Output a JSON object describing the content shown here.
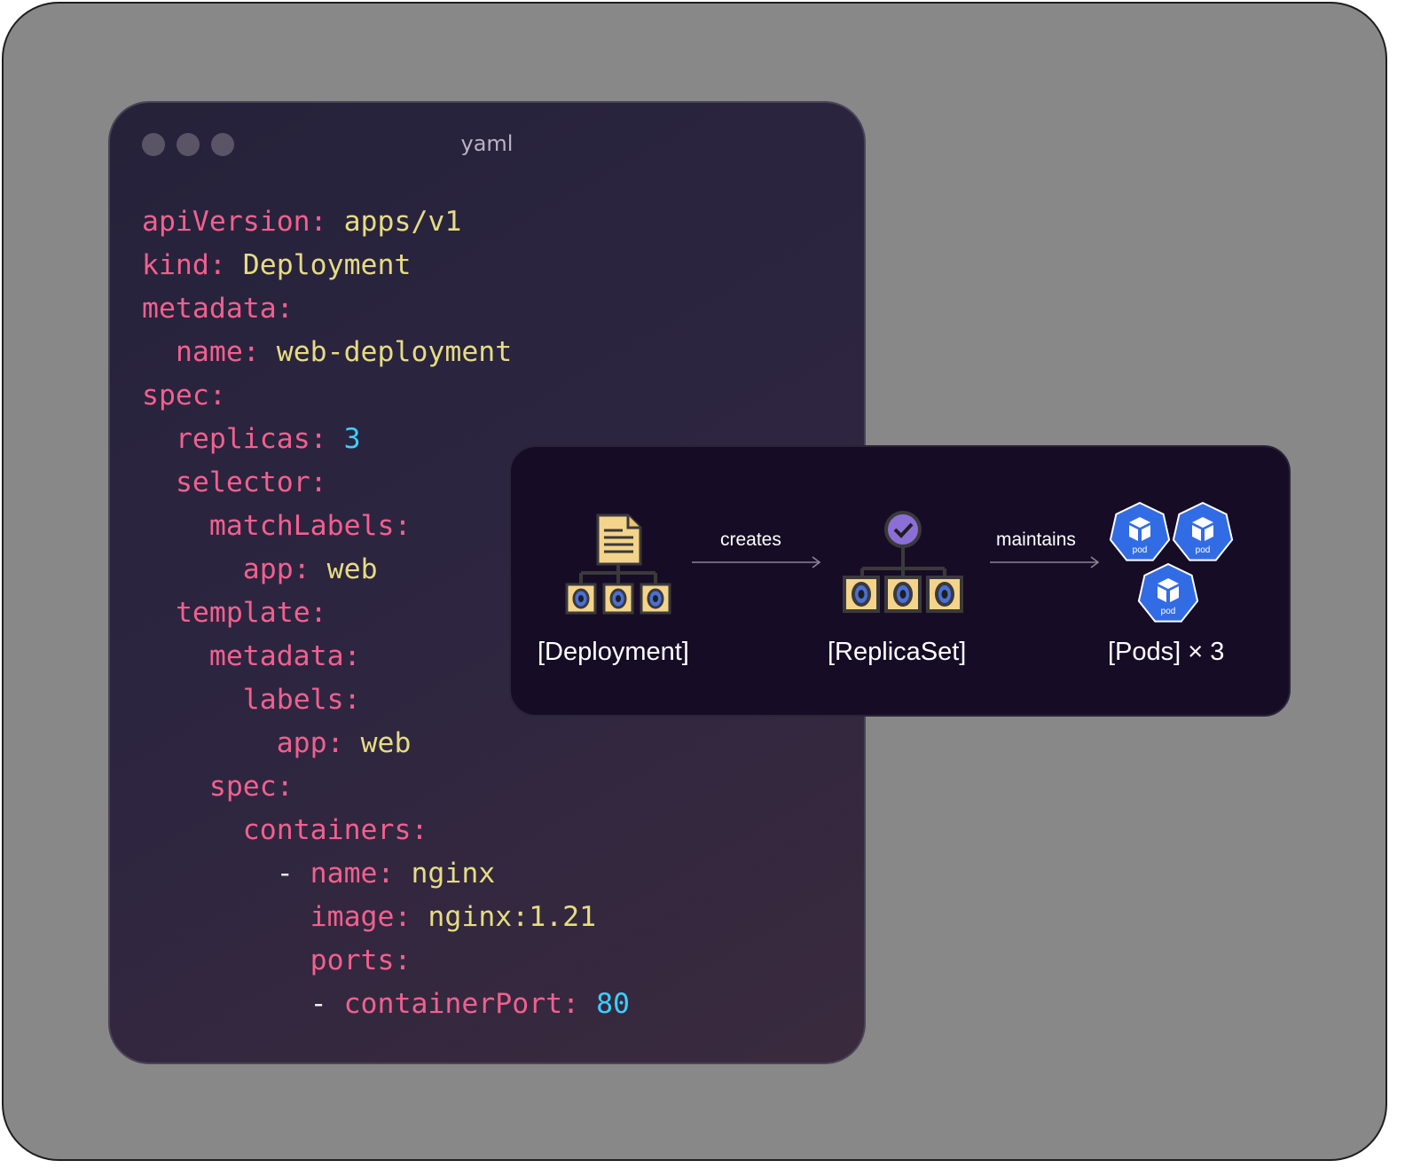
{
  "editor": {
    "title": "yaml",
    "lines": [
      {
        "indent": "",
        "dash": "",
        "key": "apiVersion",
        "value": "apps/v1",
        "vtype": "s"
      },
      {
        "indent": "",
        "dash": "",
        "key": "kind",
        "value": "Deployment",
        "vtype": "s"
      },
      {
        "indent": "",
        "dash": "",
        "key": "metadata",
        "value": "",
        "vtype": "s"
      },
      {
        "indent": "  ",
        "dash": "",
        "key": "name",
        "value": "web-deployment",
        "vtype": "s"
      },
      {
        "indent": "",
        "dash": "",
        "key": "spec",
        "value": "",
        "vtype": "s"
      },
      {
        "indent": "  ",
        "dash": "",
        "key": "replicas",
        "value": "3",
        "vtype": "n"
      },
      {
        "indent": "  ",
        "dash": "",
        "key": "selector",
        "value": "",
        "vtype": "s"
      },
      {
        "indent": "    ",
        "dash": "",
        "key": "matchLabels",
        "value": "",
        "vtype": "s"
      },
      {
        "indent": "      ",
        "dash": "",
        "key": "app",
        "value": "web",
        "vtype": "s"
      },
      {
        "indent": "  ",
        "dash": "",
        "key": "template",
        "value": "",
        "vtype": "s"
      },
      {
        "indent": "    ",
        "dash": "",
        "key": "metadata",
        "value": "",
        "vtype": "s"
      },
      {
        "indent": "      ",
        "dash": "",
        "key": "labels",
        "value": "",
        "vtype": "s"
      },
      {
        "indent": "        ",
        "dash": "",
        "key": "app",
        "value": "web",
        "vtype": "s"
      },
      {
        "indent": "    ",
        "dash": "",
        "key": "spec",
        "value": "",
        "vtype": "s"
      },
      {
        "indent": "      ",
        "dash": "",
        "key": "containers",
        "value": "",
        "vtype": "s"
      },
      {
        "indent": "        ",
        "dash": "- ",
        "key": "name",
        "value": "nginx",
        "vtype": "s"
      },
      {
        "indent": "          ",
        "dash": "",
        "key": "image",
        "value": "nginx:1.21",
        "vtype": "s"
      },
      {
        "indent": "          ",
        "dash": "",
        "key": "ports",
        "value": "",
        "vtype": "s"
      },
      {
        "indent": "          ",
        "dash": "- ",
        "key": "containerPort",
        "value": "80",
        "vtype": "n"
      }
    ]
  },
  "diagram": {
    "nodes": {
      "deployment": "[Deployment]",
      "replicaset": "[ReplicaSet]",
      "pods": "[Pods] × 3"
    },
    "edges": {
      "creates": "creates",
      "maintains": "maintains"
    },
    "pod_badge": "pod",
    "colors": {
      "node_fill": "#f4d48a",
      "container_blue": "#4a6fd8",
      "check_purple": "#8b6fd6",
      "pod_blue": "#326ce5"
    }
  }
}
